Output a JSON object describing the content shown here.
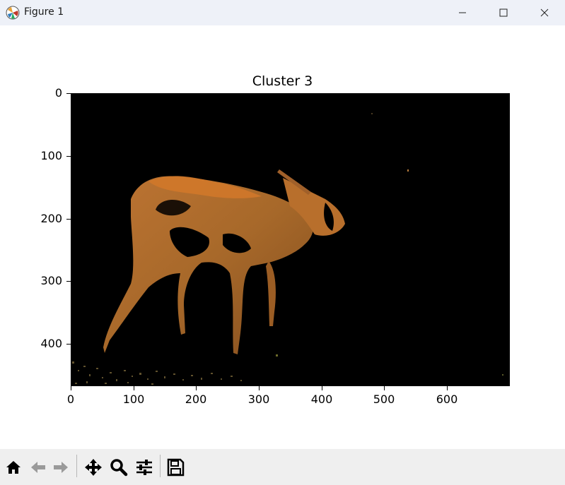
{
  "window": {
    "title": "Figure 1",
    "controls": [
      "minimize",
      "maximize",
      "close"
    ]
  },
  "plot": {
    "title": "Cluster 3",
    "y_ticks": [
      "0",
      "100",
      "200",
      "300",
      "400"
    ],
    "x_ticks": [
      "0",
      "100",
      "200",
      "300",
      "400",
      "500",
      "600"
    ]
  },
  "toolbar": {
    "buttons": [
      "home-icon",
      "back-icon",
      "forward-icon",
      "pan-icon",
      "zoom-icon",
      "configure-subplots-icon",
      "save-icon"
    ]
  },
  "colors": {
    "titlebar": "#eef1f8",
    "axes_background": "#000000",
    "subject": "#b06e2c",
    "toolbar": "#efefef"
  }
}
